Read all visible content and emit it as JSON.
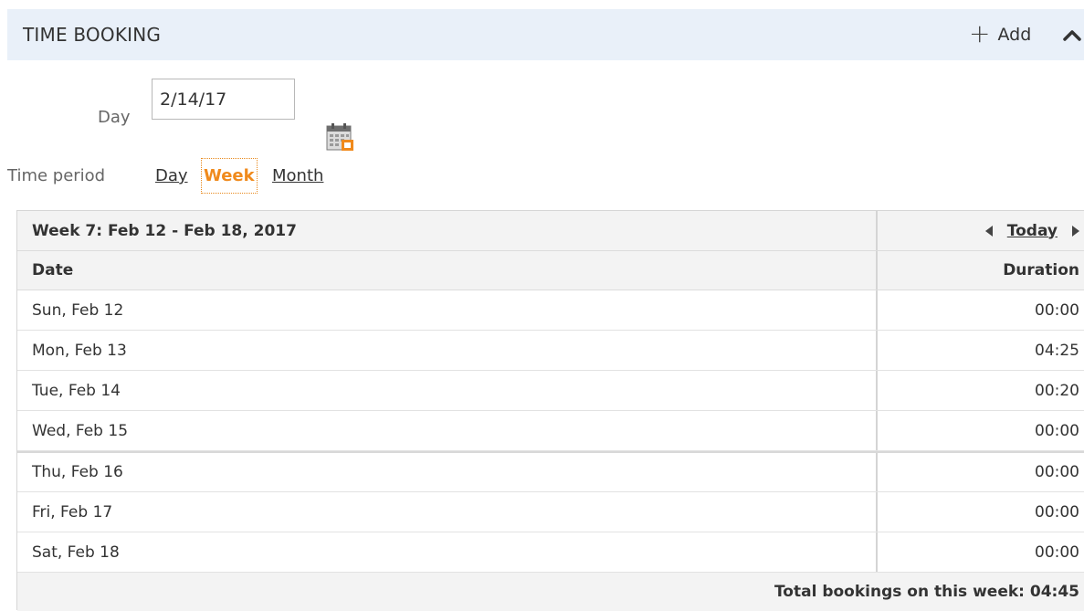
{
  "panel": {
    "title": "TIME BOOKING",
    "add_label": "Add"
  },
  "filters": {
    "day_label": "Day",
    "day_value": "2/14/17",
    "time_period_label": "Time period",
    "period_options": [
      "Day",
      "Week",
      "Month"
    ],
    "selected_period": "Week"
  },
  "grid": {
    "week_title": "Week 7: Feb 12 - Feb 18, 2017",
    "today_label": "Today",
    "columns": [
      "Date",
      "Duration"
    ],
    "rows": [
      {
        "date": "Sun, Feb 12",
        "duration": "00:00"
      },
      {
        "date": "Mon, Feb 13",
        "duration": "04:25"
      },
      {
        "date": "Tue, Feb 14",
        "duration": "00:20"
      },
      {
        "date": "Wed, Feb 15",
        "duration": "00:00"
      },
      {
        "date": "Thu, Feb 16",
        "duration": "00:00"
      },
      {
        "date": "Fri, Feb 17",
        "duration": "00:00"
      },
      {
        "date": "Sat, Feb 18",
        "duration": "00:00"
      }
    ],
    "total_label": "Total bookings on this week: 04:45"
  },
  "colors": {
    "header_bg": "#e9f0f9",
    "accent": "#f08a1c"
  },
  "icons": {
    "add": "plus-icon",
    "collapse": "chevron-up-icon",
    "calendar": "calendar-icon",
    "prev": "triangle-left-icon",
    "next": "triangle-right-icon"
  }
}
